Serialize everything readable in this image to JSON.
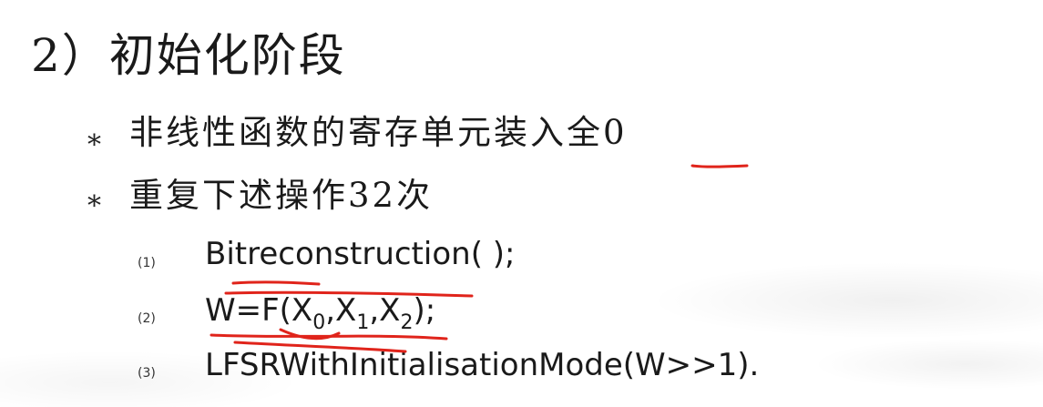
{
  "title": "2）初始化阶段",
  "bullets": [
    {
      "marker": "*",
      "text": "非线性函数的寄存单元装入全0"
    },
    {
      "marker": "*",
      "text": "重复下述操作32次"
    }
  ],
  "steps": [
    {
      "number": "(1)",
      "text": "Bitreconstruction(  );"
    },
    {
      "number": "(2)",
      "prefix": "W=F(X",
      "sub0": "0",
      "sep1": ",X",
      "sub1": "1",
      "sep2": ",X",
      "sub2": "2",
      "suffix": ");"
    },
    {
      "number": "(3)",
      "text": "LFSRWithInitialisationMode(W>>1)."
    }
  ],
  "colors": {
    "text": "#1a1a1a",
    "annotation": "#e0241b"
  }
}
